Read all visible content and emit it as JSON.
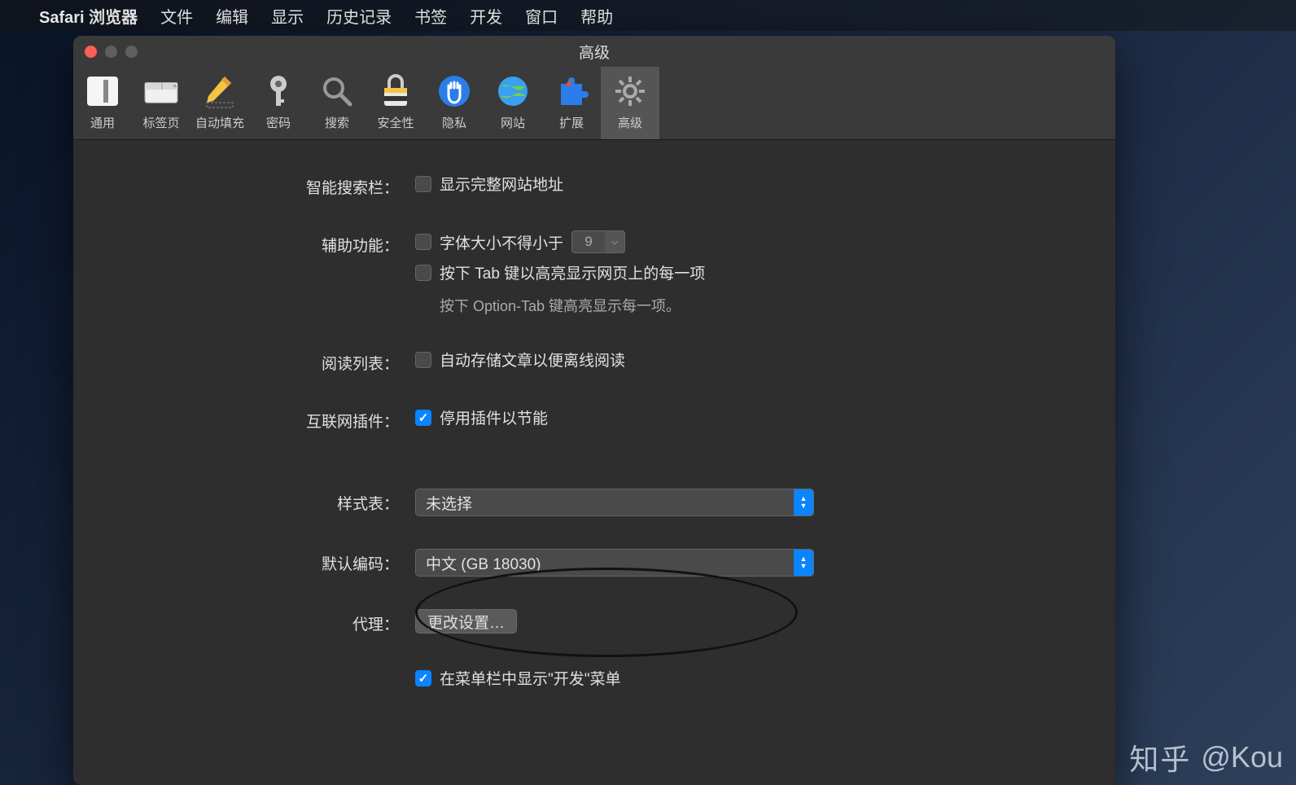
{
  "menubar": {
    "app_name": "Safari 浏览器",
    "items": [
      "文件",
      "编辑",
      "显示",
      "历史记录",
      "书签",
      "开发",
      "窗口",
      "帮助"
    ]
  },
  "window": {
    "title": "高级"
  },
  "toolbar": {
    "items": [
      {
        "label": "通用",
        "icon": "switch-icon"
      },
      {
        "label": "标签页",
        "icon": "tabs-icon"
      },
      {
        "label": "自动填充",
        "icon": "pencil-icon"
      },
      {
        "label": "密码",
        "icon": "key-icon"
      },
      {
        "label": "搜索",
        "icon": "magnify-icon"
      },
      {
        "label": "安全性",
        "icon": "lock-icon"
      },
      {
        "label": "隐私",
        "icon": "hand-icon"
      },
      {
        "label": "网站",
        "icon": "globe-icon"
      },
      {
        "label": "扩展",
        "icon": "puzzle-icon"
      },
      {
        "label": "高级",
        "icon": "gear-icon",
        "selected": true
      }
    ]
  },
  "panel": {
    "smart_search_label": "智能搜索栏：",
    "show_full_url_label": "显示完整网站地址",
    "accessibility_label": "辅助功能：",
    "font_min_label": "字体大小不得小于",
    "font_min_value": "9",
    "tab_highlight_label": "按下 Tab 键以高亮显示网页上的每一项",
    "option_tab_hint": "按下 Option-Tab 键高亮显示每一项。",
    "reading_list_label": "阅读列表：",
    "save_offline_label": "自动存储文章以便离线阅读",
    "internet_plugins_label": "互联网插件：",
    "disable_plugins_label": "停用插件以节能",
    "stylesheet_label": "样式表：",
    "stylesheet_value": "未选择",
    "encoding_label": "默认编码：",
    "encoding_value": "中文 (GB 18030)",
    "proxy_label": "代理：",
    "proxy_button": "更改设置…",
    "show_develop_label": "在菜单栏中显示\"开发\"菜单"
  },
  "watermark": {
    "zhihu": "知乎",
    "author": "@Kou"
  }
}
